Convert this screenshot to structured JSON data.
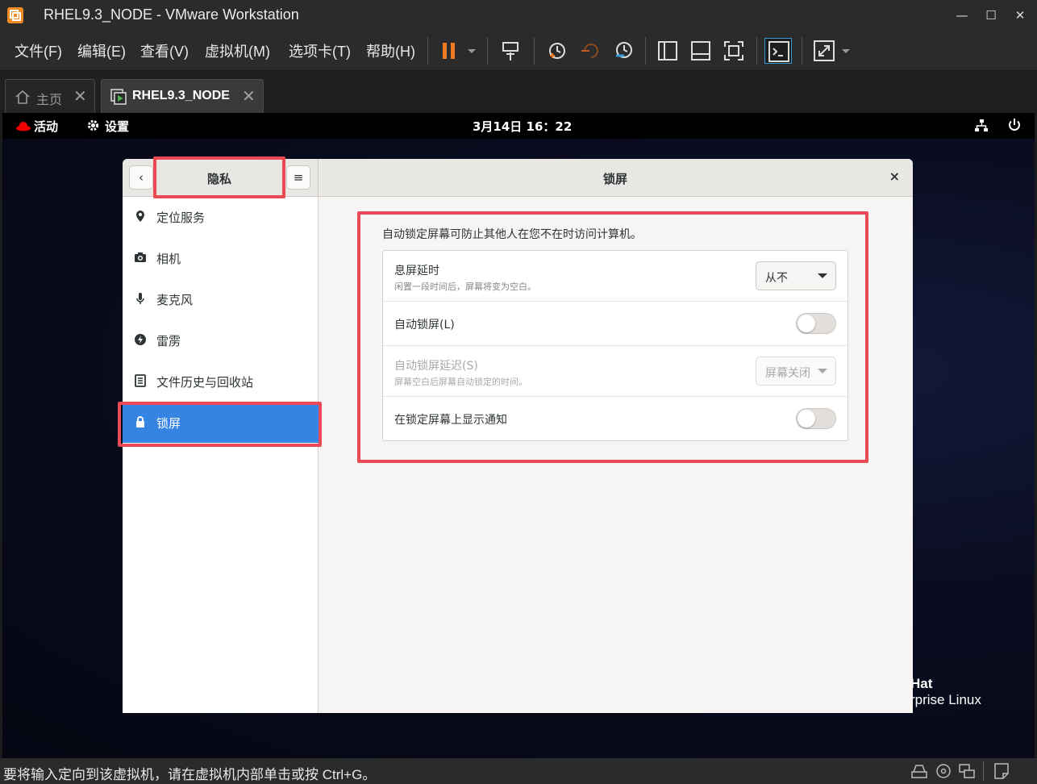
{
  "window": {
    "title": "RHEL9.3_NODE - VMware Workstation",
    "minimize": "—",
    "maximize": "☐",
    "close": "✕"
  },
  "menu": {
    "items": [
      "文件(F)",
      "编辑(E)",
      "查看(V)",
      "虚拟机(M)",
      "选项卡(T)",
      "帮助(H)"
    ]
  },
  "toolbar": {
    "icons": [
      "pause-icon",
      "send-keys-icon",
      "snapshot-icon",
      "revert-snapshot-icon",
      "snapshot-manager-icon",
      "library-view-icon",
      "thumbnail-view-icon",
      "fullscreen-icon",
      "console-icon",
      "stretch-icon"
    ]
  },
  "tabs": [
    {
      "label": "主页",
      "icon": "home-icon"
    },
    {
      "label": "RHEL9.3_NODE",
      "icon": "vm-icon"
    }
  ],
  "gnome": {
    "activities": "活动",
    "settings_app": "设置",
    "clock": "3月14日 16：22",
    "watermark_line1": "Hat",
    "watermark_line2": "rprise Linux"
  },
  "settings": {
    "panel_title": "隐私",
    "page_title": "锁屏",
    "back_glyph": "‹",
    "menu_glyph": "≡",
    "close_glyph": "×",
    "sidebar": [
      {
        "label": "定位服务",
        "icon": "location-icon"
      },
      {
        "label": "相机",
        "icon": "camera-icon"
      },
      {
        "label": "麦克风",
        "icon": "microphone-icon"
      },
      {
        "label": "雷雳",
        "icon": "thunderbolt-icon"
      },
      {
        "label": "文件历史与回收站",
        "icon": "file-history-icon"
      },
      {
        "label": "锁屏",
        "icon": "lock-icon",
        "selected": true
      }
    ],
    "description": "自动锁定屏幕可防止其他人在您不在时访问计算机。",
    "rows": {
      "blank_delay": {
        "title": "息屏延时",
        "subtitle": "闲置一段时间后，屏幕将变为空白。",
        "value": "从不"
      },
      "auto_lock": {
        "title": "自动锁屏(L)",
        "enabled": false
      },
      "lock_delay": {
        "title": "自动锁屏延迟(S)",
        "subtitle": "屏幕空白后屏幕自动锁定的时间。",
        "value": "屏幕关闭",
        "disabled": true
      },
      "show_notifications": {
        "title": "在锁定屏幕上显示通知",
        "enabled": false
      }
    }
  },
  "statusbar": {
    "text": "要将输入定向到该虚拟机，请在虚拟机内部单击或按 Ctrl+G。"
  },
  "colors": {
    "accent": "#3584e4",
    "highlight": "#e94a55",
    "pause": "#f07a20"
  }
}
